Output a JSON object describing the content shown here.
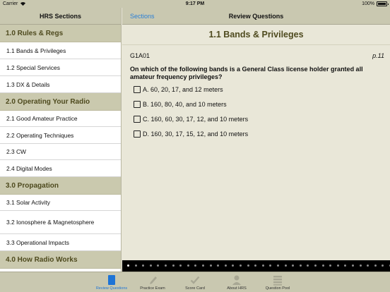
{
  "status": {
    "carrier": "Carrier",
    "time": "9:17 PM",
    "battery": "100%"
  },
  "sidebar": {
    "title": "HRS Sections",
    "sections": [
      {
        "title": "1.0 Rules & Regs",
        "items": [
          "1.1 Bands & Privileges",
          "1.2 Special Services",
          "1.3 DX & Details"
        ]
      },
      {
        "title": "2.0 Operating Your Radio",
        "items": [
          "2.1 Good Amateur Practice",
          "2.2 Operating Techniques",
          "2.3 CW",
          "2.4 Digital Modes"
        ]
      },
      {
        "title": "3.0 Propagation",
        "items": [
          "3.1 Solar Activity",
          "3.2 Ionosphere & Magnetosphere",
          "3.3 Operational Impacts"
        ]
      },
      {
        "title": "4.0 How Radio Works",
        "items": []
      }
    ]
  },
  "main": {
    "back_label": "Sections",
    "nav_title": "Review Questions",
    "question_title": "1.1 Bands & Privileges",
    "question_id": "G1A01",
    "page_ref": "p.11",
    "question_text": "On which of the following bands is a General Class license holder granted all amateur frequency privileges?",
    "answers": [
      "A. 60, 20, 17, and 12 meters",
      "B. 160, 80, 40, and 10 meters",
      "C. 160, 60, 30, 17, 12, and 10 meters",
      "D. 160, 30, 17, 15, 12, and 10 meters"
    ]
  },
  "pager": {
    "count": 36,
    "active_index": 0
  },
  "tabbar": {
    "tabs": [
      {
        "label": "Review Questions",
        "icon": "book-icon",
        "active": true
      },
      {
        "label": "Practice Exam",
        "icon": "pencil-icon",
        "active": false
      },
      {
        "label": "Score Card",
        "icon": "checkmark-icon",
        "active": false
      },
      {
        "label": "About HRS",
        "icon": "person-icon",
        "active": false
      },
      {
        "label": "Question Pool",
        "icon": "list-icon",
        "active": false
      }
    ]
  },
  "colors": {
    "accent": "#2a7fd6",
    "section_text": "#4e4a1e",
    "bar": "#c9c8b0",
    "tab_active": "#1e74d6"
  }
}
